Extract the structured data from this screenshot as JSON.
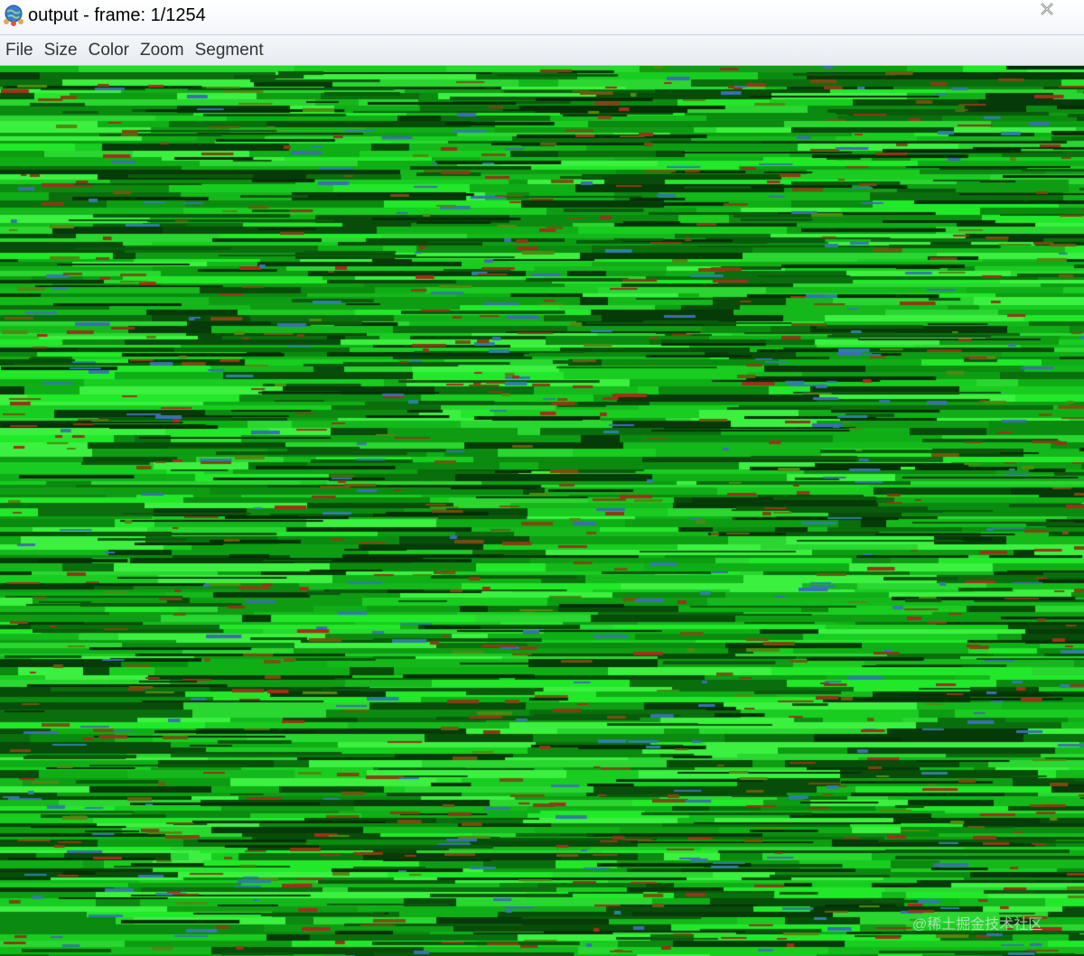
{
  "window": {
    "title": "output - frame: 1/1254",
    "app_icon": "globe-people-icon",
    "close_icon": "close-icon"
  },
  "menu": {
    "items": [
      {
        "label": "File"
      },
      {
        "label": "Size"
      },
      {
        "label": "Color"
      },
      {
        "label": "Zoom"
      },
      {
        "label": "Segment"
      }
    ]
  },
  "viewer": {
    "content": "green-dominant noisy frame with horizontal streaks",
    "dominant_color": "#12c21a",
    "accent_colors": [
      "#0b7d0f",
      "#22e82a",
      "#063a08",
      "#8a3a16",
      "#2f7fa0",
      "#4f8a10"
    ]
  },
  "watermark": {
    "text": "@稀土掘金技术社区"
  }
}
